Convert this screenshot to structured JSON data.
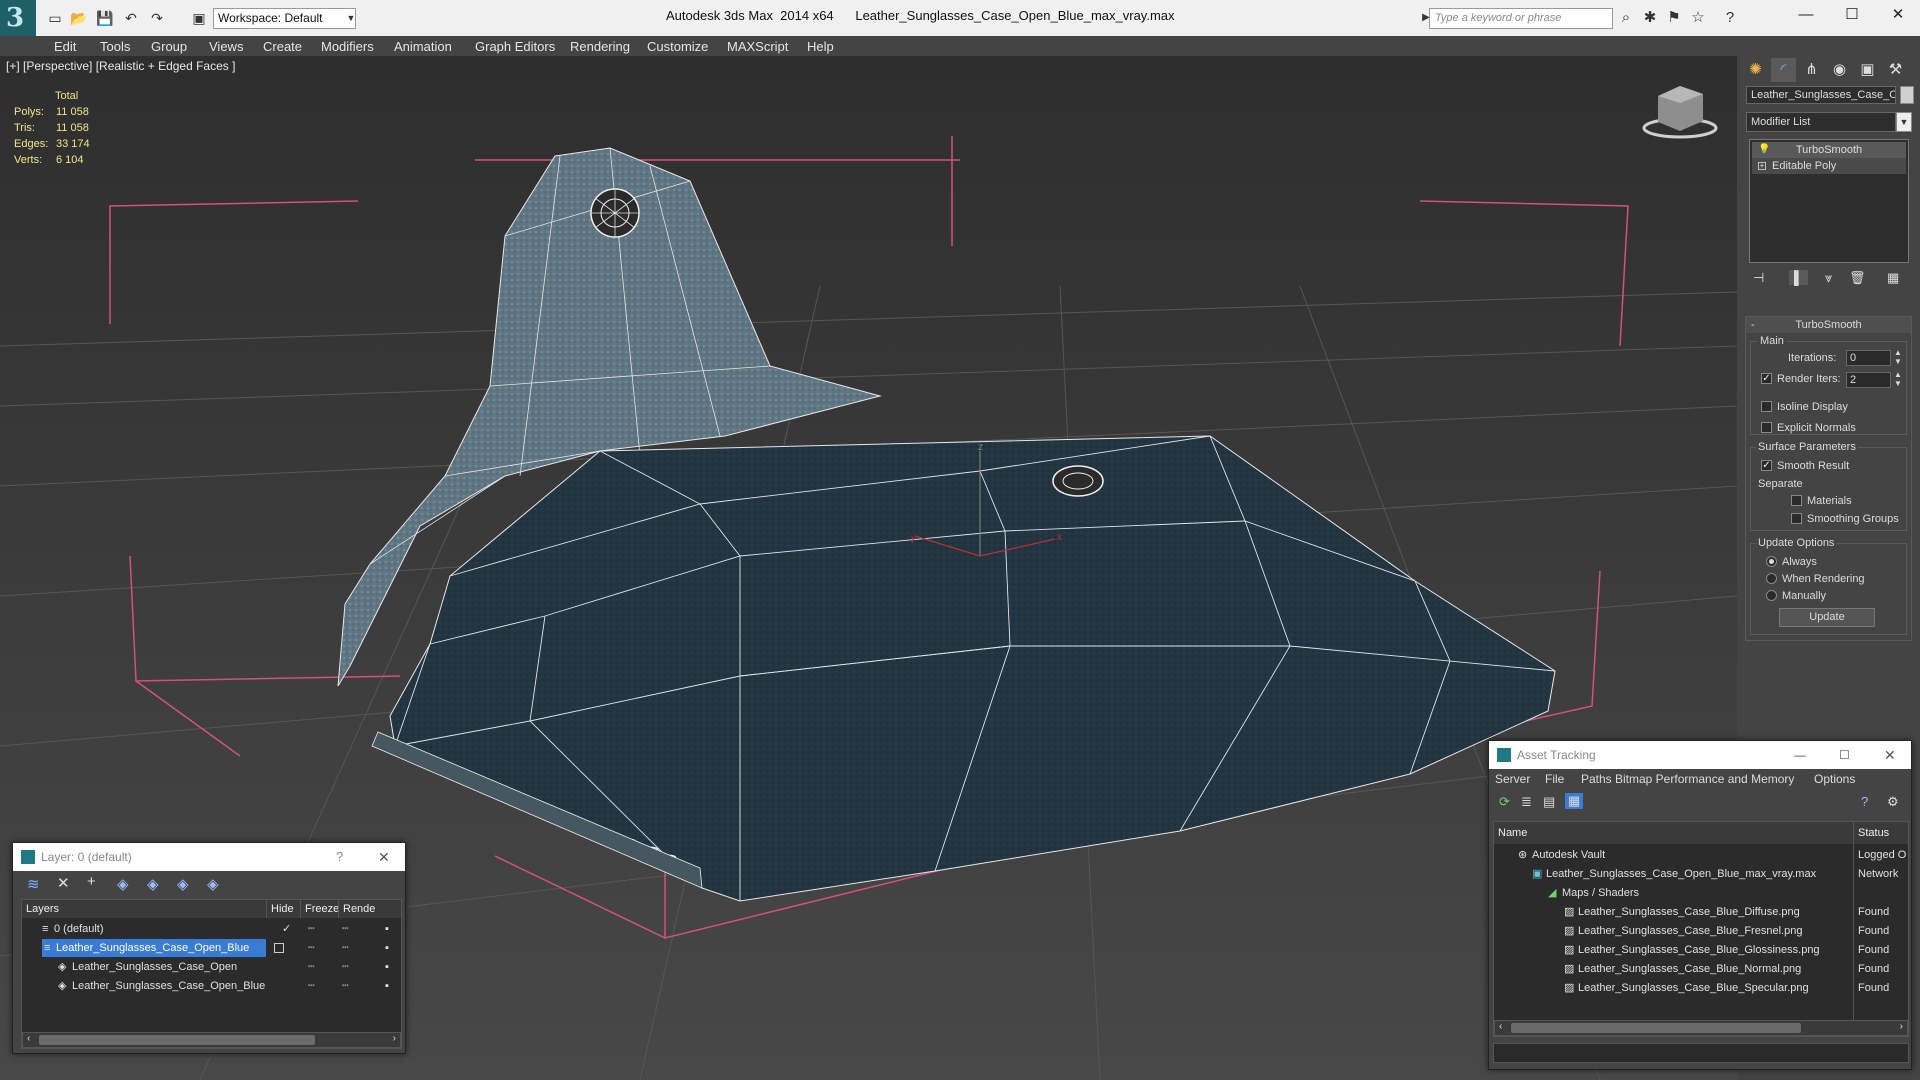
{
  "app": {
    "title": "Autodesk 3ds Max  2014 x64",
    "file": "Leather_Sunglasses_Case_Open_Blue_max_vray.max",
    "workspace": "Workspace: Default",
    "search_placeholder": "Type a keyword or phrase",
    "logo": "3"
  },
  "menu": [
    "Edit",
    "Tools",
    "Group",
    "Views",
    "Create",
    "Modifiers",
    "Animation",
    "Graph Editors",
    "Rendering",
    "Customize",
    "MAXScript",
    "Help"
  ],
  "viewport": {
    "label": "[+] [Perspective] [Realistic + Edged Faces ]",
    "stats": {
      "header": "Total",
      "rows": [
        {
          "label": "Polys:",
          "value": "11 058"
        },
        {
          "label": "Tris:",
          "value": "11 058"
        },
        {
          "label": "Edges:",
          "value": "33 174"
        },
        {
          "label": "Verts:",
          "value": "6 104"
        }
      ]
    },
    "axis_labels": {
      "x": "x",
      "y": "y",
      "z": "z"
    }
  },
  "command_panel": {
    "object_name": "Leather_Sunglasses_Case_O",
    "modifier_list": "Modifier List",
    "stack": [
      "TurboSmooth",
      "Editable Poly"
    ],
    "rollout_title": "TurboSmooth",
    "main_label": "Main",
    "iterations_label": "Iterations:",
    "iterations_value": "0",
    "render_iters_label": "Render Iters:",
    "render_iters_value": "2",
    "isoline": "Isoline Display",
    "explicit": "Explicit Normals",
    "surface_params": "Surface Parameters",
    "smooth_result": "Smooth Result",
    "separate": "Separate",
    "materials": "Materials",
    "smoothing_groups": "Smoothing Groups",
    "update_options": "Update Options",
    "always": "Always",
    "when_rendering": "When Rendering",
    "manually": "Manually",
    "update_button": "Update"
  },
  "layer_window": {
    "title": "Layer: 0 (default)",
    "help": "?",
    "columns": [
      "Layers",
      "Hide",
      "Freeze",
      "Rende"
    ],
    "rows": [
      {
        "name": "0 (default)",
        "indent": 0,
        "selected": false
      },
      {
        "name": "Leather_Sunglasses_Case_Open_Blue",
        "indent": 0,
        "selected": true
      },
      {
        "name": "Leather_Sunglasses_Case_Open",
        "indent": 1,
        "selected": false
      },
      {
        "name": "Leather_Sunglasses_Case_Open_Blue",
        "indent": 1,
        "selected": false
      }
    ]
  },
  "asset_window": {
    "title": "Asset Tracking",
    "menu": [
      "Server",
      "File",
      "Paths",
      "Bitmap Performance and Memory",
      "Options"
    ],
    "columns": [
      "Name",
      "Status"
    ],
    "rows": [
      {
        "name": "Autodesk Vault",
        "status": "Logged O",
        "indent": 1
      },
      {
        "name": "Leather_Sunglasses_Case_Open_Blue_max_vray.max",
        "status": "Network",
        "indent": 2
      },
      {
        "name": "Maps / Shaders",
        "status": "",
        "indent": 3
      },
      {
        "name": "Leather_Sunglasses_Case_Blue_Diffuse.png",
        "status": "Found",
        "indent": 4
      },
      {
        "name": "Leather_Sunglasses_Case_Blue_Fresnel.png",
        "status": "Found",
        "indent": 4
      },
      {
        "name": "Leather_Sunglasses_Case_Blue_Glossiness.png",
        "status": "Found",
        "indent": 4
      },
      {
        "name": "Leather_Sunglasses_Case_Blue_Normal.png",
        "status": "Found",
        "indent": 4
      },
      {
        "name": "Leather_Sunglasses_Case_Blue_Specular.png",
        "status": "Found",
        "indent": 4
      }
    ]
  },
  "colors": {
    "accent": "#3a7bd5",
    "case_lid": "#5e7480",
    "case_body": "#22343d",
    "bbox": "#d2527a"
  }
}
